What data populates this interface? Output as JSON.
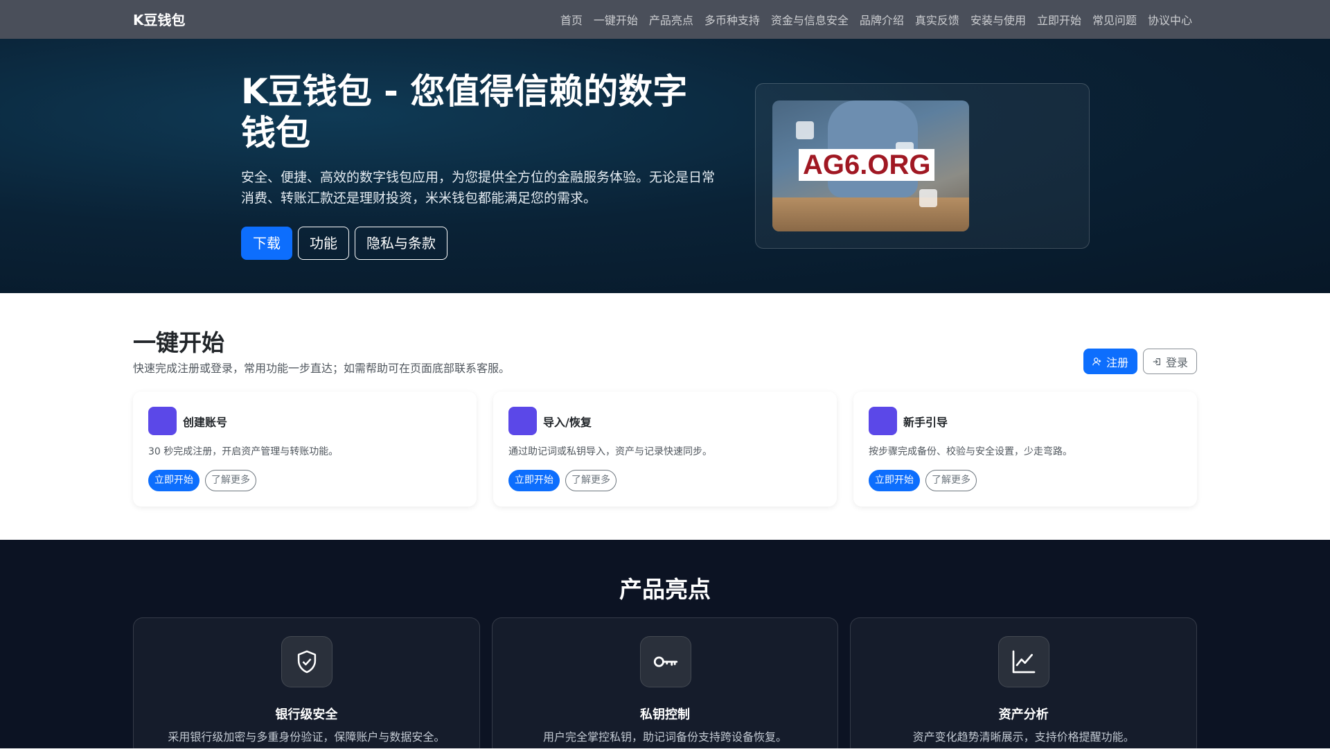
{
  "navbar": {
    "brand": "K豆钱包",
    "links": [
      "首页",
      "一键开始",
      "产品亮点",
      "多币种支持",
      "资金与信息安全",
      "品牌介绍",
      "真实反馈",
      "安装与使用",
      "立即开始",
      "常见问题",
      "协议中心"
    ]
  },
  "hero": {
    "title": "K豆钱包 - 您值得信赖的数字钱包",
    "subtitle": "安全、便捷、高效的数字钱包应用，为您提供全方位的金融服务体验。无论是日常消费、转账汇款还是理财投资，米米钱包都能满足您的需求。",
    "buttons": {
      "download": "下载",
      "features": "功能",
      "privacy": "隐私与条款"
    },
    "image_watermark": "AG6.ORG"
  },
  "quick_start": {
    "title": "一键开始",
    "subtitle": "快速完成注册或登录，常用功能一步直达；如需帮助可在页面底部联系客服。",
    "register_label": "注册",
    "login_label": "登录",
    "cards": [
      {
        "title": "创建账号",
        "desc": "30 秒完成注册，开启资产管理与转账功能。",
        "primary": "立即开始",
        "secondary": "了解更多"
      },
      {
        "title": "导入/恢复",
        "desc": "通过助记词或私钥导入，资产与记录快速同步。",
        "primary": "立即开始",
        "secondary": "了解更多"
      },
      {
        "title": "新手引导",
        "desc": "按步骤完成备份、校验与安全设置，少走弯路。",
        "primary": "立即开始",
        "secondary": "了解更多"
      }
    ]
  },
  "features": {
    "title": "产品亮点",
    "cards": [
      {
        "icon": "shield-check-icon",
        "title": "银行级安全",
        "desc": "采用银行级加密与多重身份验证，保障账户与数据安全。"
      },
      {
        "icon": "key-icon",
        "title": "私钥控制",
        "desc": "用户完全掌控私钥，助记词备份支持跨设备恢复。"
      },
      {
        "icon": "line-chart-icon",
        "title": "资产分析",
        "desc": "资产变化趋势清晰展示，支持价格提醒功能。"
      }
    ]
  },
  "colors": {
    "primary": "#0d6efd",
    "nav_bg": "#4a4f5a",
    "card_square": "#5b48e8",
    "features_bg": "#0c1323"
  }
}
